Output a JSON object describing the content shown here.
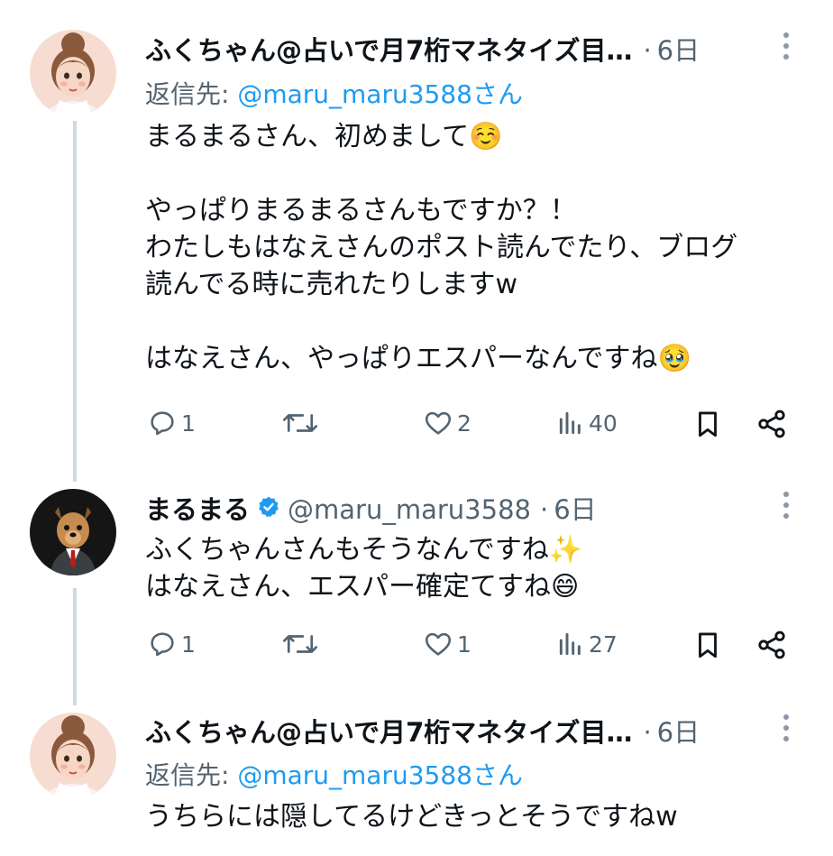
{
  "tweets": [
    {
      "display_name": "ふくちゃん@占いで月7桁マネタイズ目…",
      "time": "6日",
      "reply_prefix": "返信先:",
      "reply_to": "@maru_maru3588さん",
      "lines": [
        "まるまるさん、初めまして☺️",
        "",
        "やっぱりまるまるさんもですか？！",
        "わたしもはなえさんのポスト読んでたり、ブログ",
        "読んでる時に売れたりしますw",
        "",
        "はなえさん、やっぱりエスパーなんですね🥹"
      ],
      "replies": "1",
      "likes": "2",
      "views": "40"
    },
    {
      "display_name": "まるまる",
      "handle": "@maru_maru3588",
      "time": "6日",
      "lines": [
        "ふくちゃんさんもそうなんですね✨",
        "はなえさん、エスパー確定てすね😄"
      ],
      "replies": "1",
      "likes": "1",
      "views": "27"
    },
    {
      "display_name": "ふくちゃん@占いで月7桁マネタイズ目…",
      "time": "6日",
      "reply_prefix": "返信先:",
      "reply_to": "@maru_maru3588さん",
      "lines": [
        "うちらには隠してるけどきっとそうですねw"
      ]
    }
  ],
  "separator": "·",
  "colors": {
    "accent": "#1d9bf0",
    "muted": "#536471",
    "text": "#0f1419",
    "thread_line": "#cfd9de"
  },
  "icons": [
    "more-vertical-icon",
    "reply-icon",
    "repost-icon",
    "like-icon",
    "views-icon",
    "bookmark-icon",
    "share-icon",
    "verified-badge-icon"
  ]
}
